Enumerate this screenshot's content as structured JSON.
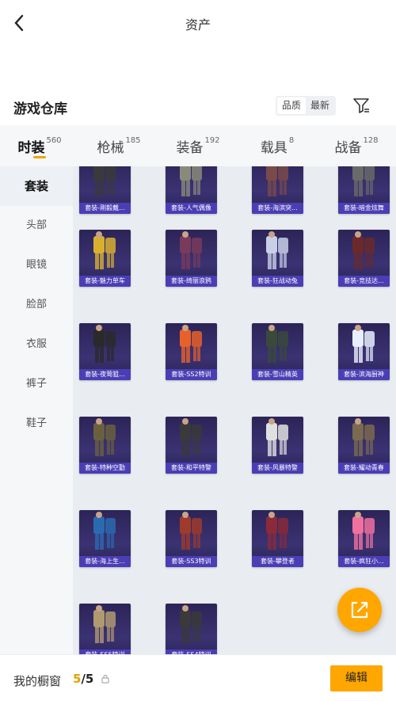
{
  "header": {
    "title": "资产"
  },
  "section": {
    "title": "游戏仓库",
    "sort_options": [
      "品质",
      "最新"
    ],
    "active_sort": 0
  },
  "categories": [
    {
      "name": "时装",
      "count": "560"
    },
    {
      "name": "枪械",
      "count": "185"
    },
    {
      "name": "装备",
      "count": "192"
    },
    {
      "name": "载具",
      "count": "8"
    },
    {
      "name": "战备",
      "count": "128"
    }
  ],
  "sidebar": [
    "套装",
    "头部",
    "眼镜",
    "脸部",
    "衣服",
    "裤子",
    "鞋子"
  ],
  "items": [
    "套装-刚毅戴...",
    "套装-人气偶像",
    "套装-海滨突...",
    "套装-暗金炫舞",
    "套装-魅力单车",
    "套装-绮丽浪鸦",
    "套装-狂战动兔",
    "套装-竞技达...",
    "套装-夜莺狙...",
    "套装-SS2特训",
    "套装-雪山精英",
    "套装-滨海厨神",
    "套装-特种空勤",
    "套装-和平特警",
    "套装-风暴特警",
    "套装-耀动青春",
    "套装-海上生...",
    "套装-SS3特训",
    "套装-攀登者",
    "套装-疯狂小...",
    "套装-SS5特训",
    "套装-SS4特训"
  ],
  "item_colors": [
    "#3a3a3a",
    "#8a8a7a",
    "#7a4a4a",
    "#6a6a6a",
    "#d8b030",
    "#7a3a5a",
    "#c8d0e8",
    "#6a2a2a",
    "#2a2a2a",
    "#e8602a",
    "#3a4a3a",
    "#e8f0ff",
    "#6a6040",
    "#3a3a3a",
    "#e0e0e0",
    "#7a6a50",
    "#2a6ab0",
    "#a03a2a",
    "#8a2a3a",
    "#f070a0",
    "#b09a70",
    "#3a3a3a"
  ],
  "bottom": {
    "label": "我的橱窗",
    "count_current": "5",
    "count_sep": "/",
    "count_total": "5",
    "edit": "编辑"
  }
}
